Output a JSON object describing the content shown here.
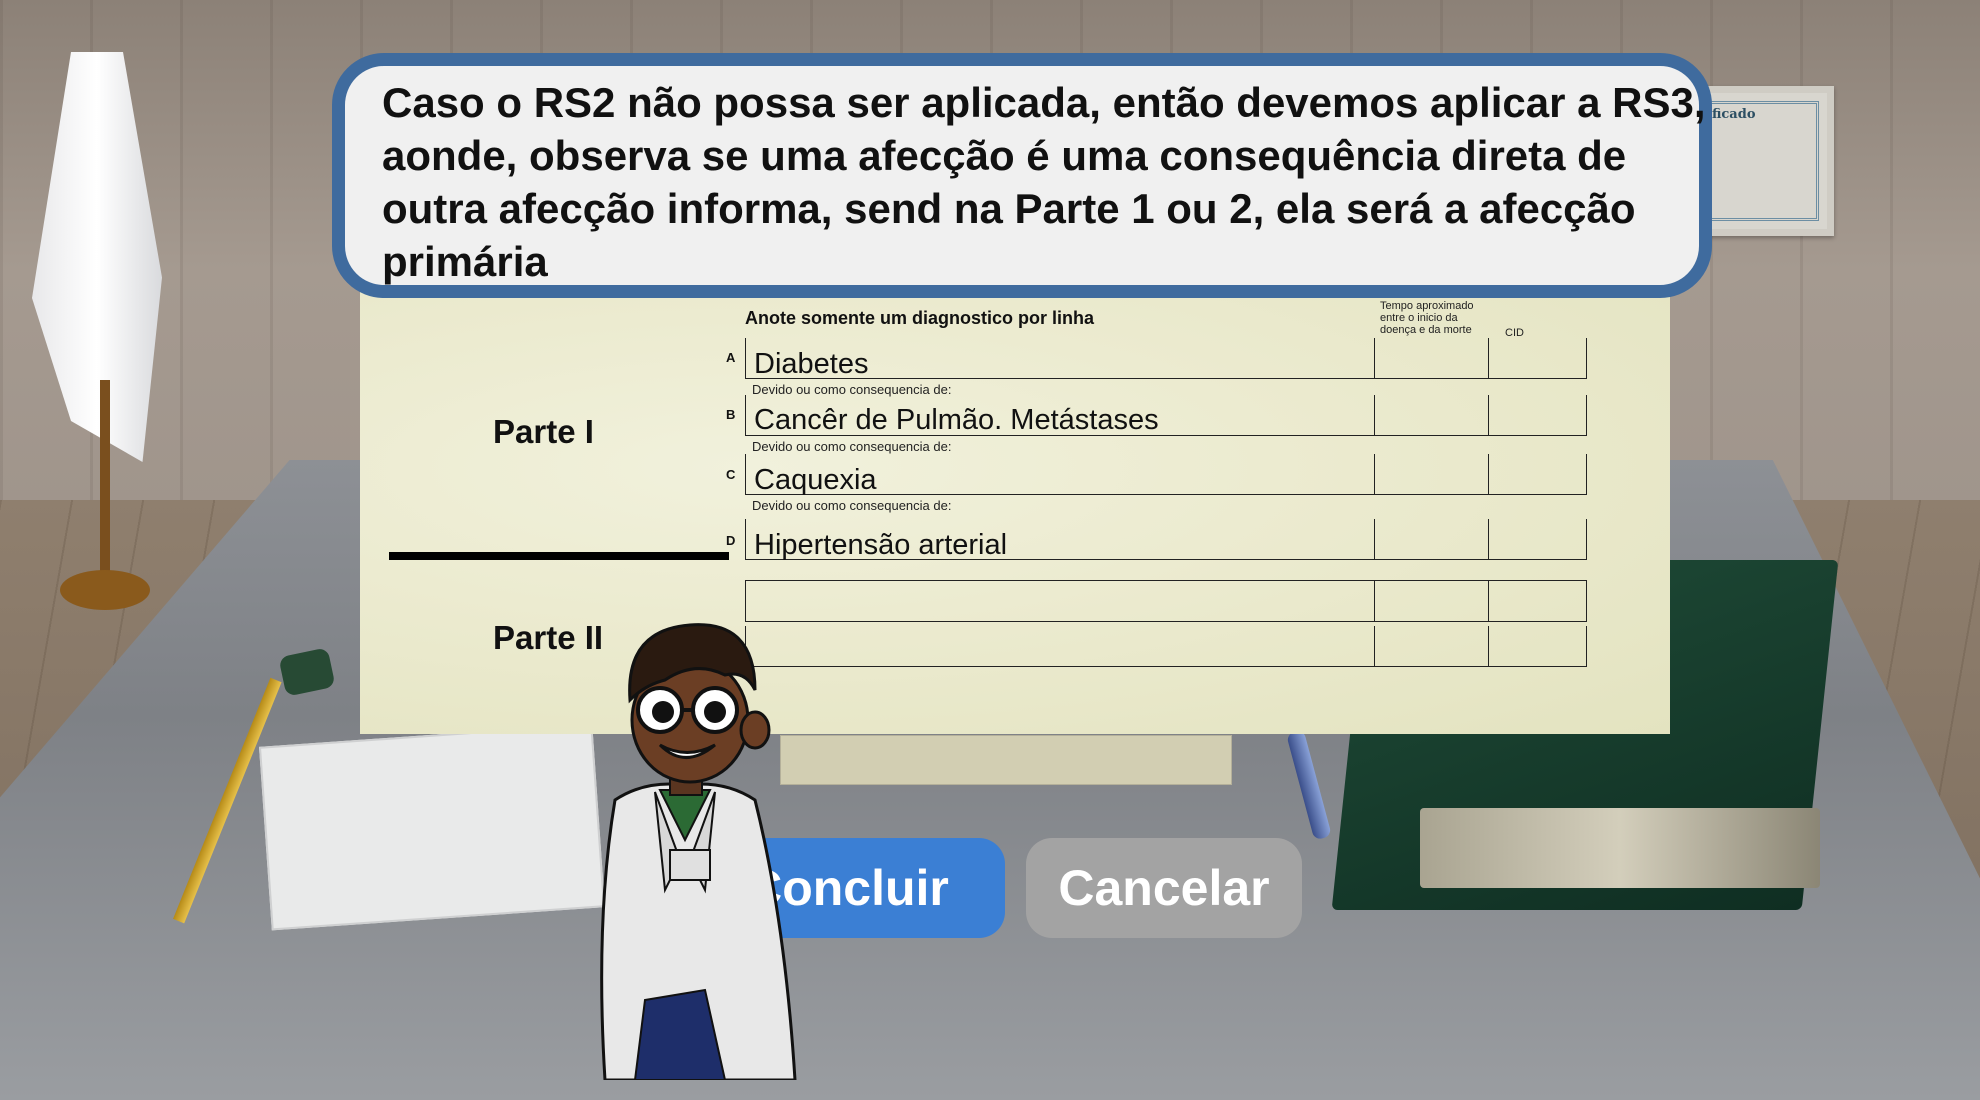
{
  "dialog": {
    "text": "Caso o RS2 não possa ser aplicada,  então devemos aplicar a RS3, aonde, observa se uma afecção é uma consequência direta de outra afecção informa, send na Parte 1 ou 2, ela será a afecção primária"
  },
  "form": {
    "heading": "Anote somente um diagnostico por linha",
    "column_time": "Tempo aproximado entre o inicio da doença e da morte",
    "column_cid": "CID",
    "part1_label": "Parte I",
    "part2_label": "Parte II",
    "note": "Devido ou como consequencia de:",
    "rows": [
      {
        "letter": "A",
        "value": "Diabetes"
      },
      {
        "letter": "B",
        "value": "Cancêr de Pulmão. Metástases"
      },
      {
        "letter": "C",
        "value": "Caquexia"
      },
      {
        "letter": "D",
        "value": "Hipertensão arterial"
      },
      {
        "letter": "",
        "value": ""
      },
      {
        "letter": "",
        "value": ""
      }
    ]
  },
  "buttons": {
    "confirm": "Concluir",
    "cancel": "Cancelar"
  },
  "scene": {
    "certificate_text": "ificado"
  },
  "colors": {
    "dialog_border": "#3f6b9e",
    "dialog_bg": "#f0f0f0",
    "primary_button": "#3b7fd4",
    "secondary_button": "#a3a3a3",
    "form_bg": "#ecebd0"
  }
}
